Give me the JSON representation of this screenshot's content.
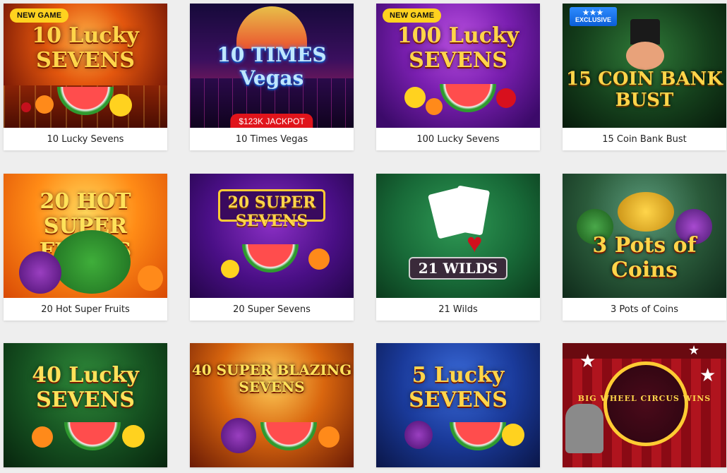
{
  "games": [
    {
      "title": "10 Lucky Sevens",
      "art": "10 Lucky SEVENS",
      "badge": "NEW GAME"
    },
    {
      "title": "10 Times Vegas",
      "art": "10 TIMES Vegas",
      "badge": "$123K JACKPOT"
    },
    {
      "title": "100 Lucky Sevens",
      "art": "100 Lucky SEVENS",
      "badge": "NEW GAME"
    },
    {
      "title": "15 Coin Bank Bust",
      "art": "15 COIN BANK BUST",
      "badge": "EXCLUSIVE"
    },
    {
      "title": "20 Hot Super Fruits",
      "art": "20 HOT SUPER FRUITS"
    },
    {
      "title": "20 Super Sevens",
      "art": "20 SUPER SEVENS"
    },
    {
      "title": "21 Wilds",
      "art": "21 WILDS"
    },
    {
      "title": "3 Pots of Coins",
      "art": "3 Pots of Coins"
    },
    {
      "title": "",
      "art": "40 Lucky SEVENS"
    },
    {
      "title": "",
      "art": "40 SUPER BLAZING SEVENS"
    },
    {
      "title": "",
      "art": "5 Lucky SEVENS"
    },
    {
      "title": "",
      "art": "BIG WHEEL CIRCUS WINS"
    }
  ],
  "colors": {
    "new_badge": "#ffd21f",
    "jackpot_badge": "#e0141b",
    "exclusive_badge": "#1f78f0",
    "page_bg": "#eeeeee"
  },
  "icons": {
    "exclusive_stars": "star-icon"
  }
}
